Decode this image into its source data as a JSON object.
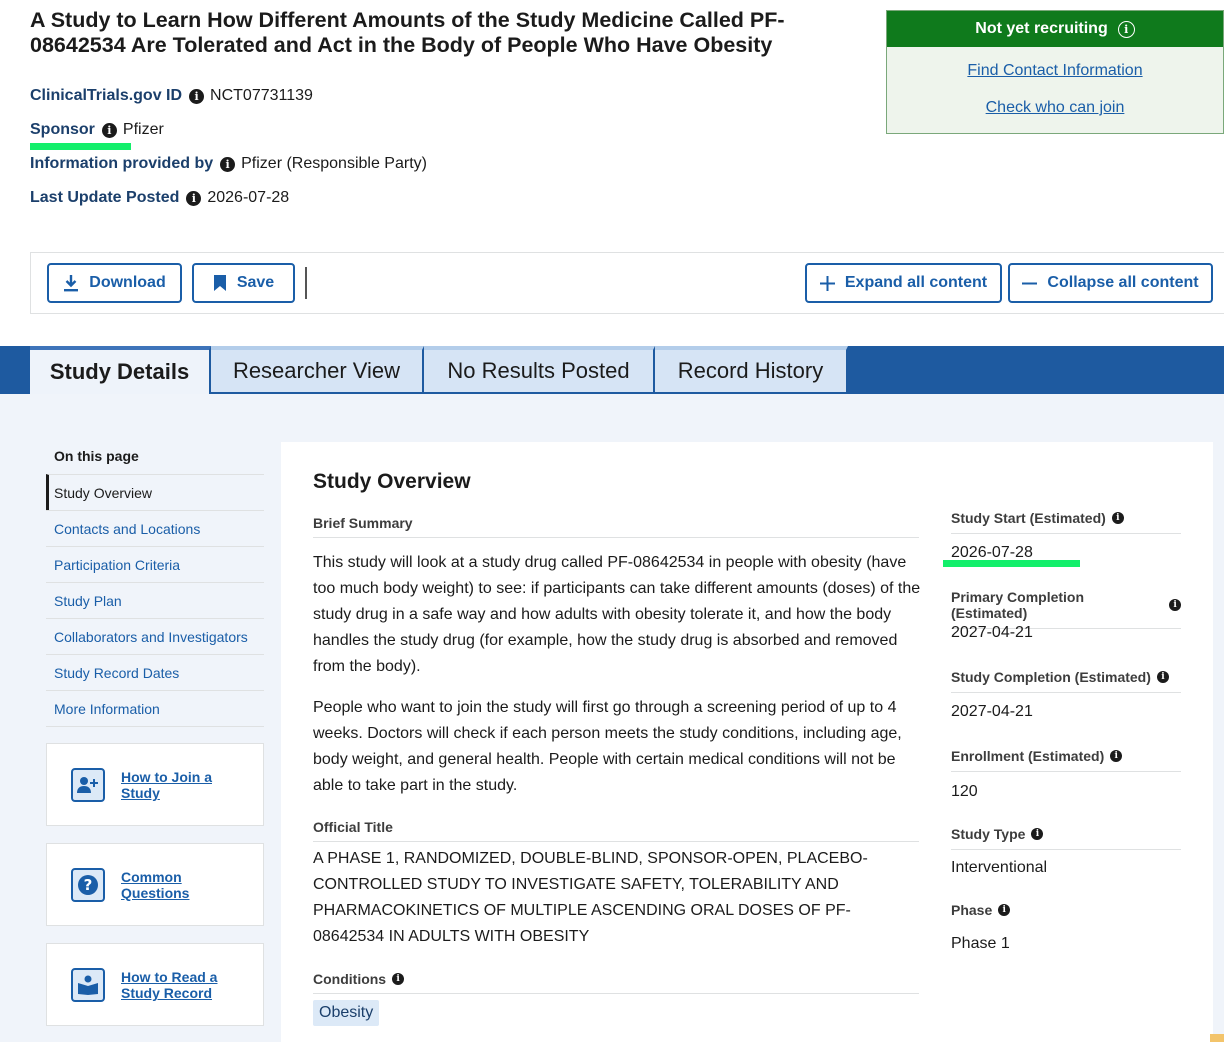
{
  "header": {
    "title": "A Study to Learn How Different Amounts of the Study Medicine Called PF-08642534 Are Tolerated and Act in the Body of People Who Have Obesity",
    "meta": [
      {
        "label": "ClinicalTrials.gov ID",
        "value": "NCT07731139"
      },
      {
        "label": "Sponsor",
        "value": "Pfizer"
      },
      {
        "label": "Information provided by",
        "value": "Pfizer (Responsible Party)"
      },
      {
        "label": "Last Update Posted",
        "value": "2026-07-28"
      }
    ]
  },
  "status": {
    "label": "Not yet recruiting",
    "find_contact": "Find Contact Information",
    "check_join": "Check who can join",
    "color": "#0f7a1c"
  },
  "toolbar": {
    "download": "Download",
    "save": "Save",
    "expand": "Expand all content",
    "collapse": "Collapse all content"
  },
  "tabs": [
    "Study Details",
    "Researcher View",
    "No Results Posted",
    "Record History"
  ],
  "sidebar": {
    "title": "On this page",
    "items": [
      "Study Overview",
      "Contacts and Locations",
      "Participation Criteria",
      "Study Plan",
      "Collaborators and Investigators",
      "Study Record Dates",
      "More Information"
    ],
    "help": [
      "How to Join a Study",
      "Common Questions",
      "How to Read a Study Record"
    ]
  },
  "overview": {
    "title": "Study Overview",
    "brief_summary_label": "Brief Summary",
    "summary_p1": "This study will look at a study drug called PF-08642534 in people with obesity (have too much body weight) to see: if participants can take different amounts (doses) of the study drug in a safe way and how adults with obesity tolerate it, and how the body handles the study drug (for example, how the study drug is absorbed and removed from the body).",
    "summary_p2": "People who want to join the study will first go through a screening period of up to 4 weeks. Doctors will check if each person meets the study conditions, including age, body weight, and general health. People with certain medical conditions will not be able to take part in the study.",
    "official_title_label": "Official Title",
    "official_title": "A PHASE 1, RANDOMIZED, DOUBLE-BLIND, SPONSOR-OPEN, PLACEBO-CONTROLLED STUDY TO INVESTIGATE SAFETY, TOLERABILITY AND PHARMACOKINETICS OF MULTIPLE ASCENDING ORAL DOSES OF PF-08642534 IN ADULTS WITH OBESITY",
    "conditions_label": "Conditions",
    "conditions": [
      "Obesity"
    ]
  },
  "facts": [
    {
      "label": "Study Start (Estimated)",
      "value": "2026-07-28"
    },
    {
      "label": "Primary Completion (Estimated)",
      "value": "2027-04-21"
    },
    {
      "label": "Study Completion (Estimated)",
      "value": "2027-04-21"
    },
    {
      "label": "Enrollment (Estimated)",
      "value": "120"
    },
    {
      "label": "Study Type",
      "value": "Interventional"
    },
    {
      "label": "Phase",
      "value": "Phase 1"
    }
  ]
}
